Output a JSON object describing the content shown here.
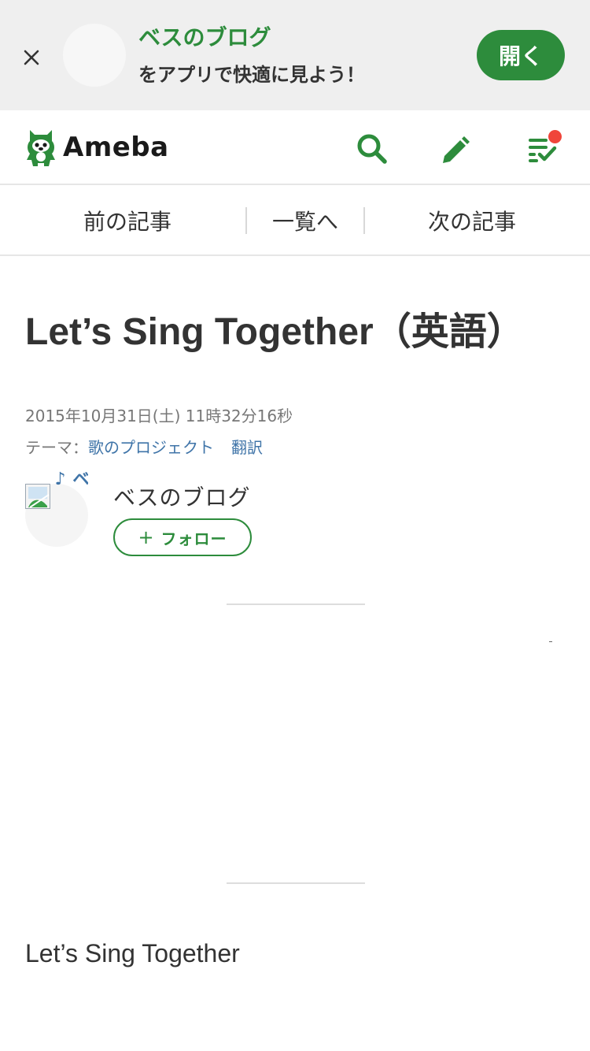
{
  "app_banner": {
    "blog_name": "ベスのブログ",
    "message": "をアプリで快適に見よう！",
    "open_label": "開く"
  },
  "header": {
    "logo_text": "Ameba",
    "icons": [
      "search-icon",
      "edit-icon",
      "reader-feed-icon"
    ],
    "notification_color": "#f0453a"
  },
  "article_nav": {
    "prev_label": "前の記事",
    "list_label": "一覧へ",
    "next_label": "次の記事"
  },
  "article": {
    "title": "Let’s Sing Together（英語）",
    "date": "2015年10月31日(土) 11時32分16秒",
    "theme_label": "テーマ：",
    "theme_links": [
      "歌のプロジェクト",
      "翻訳"
    ],
    "author_name": "ベスのブログ",
    "author_avatar_alt": "ベ♪",
    "follow_label": "フォロー",
    "follow_plus": "+",
    "body_first_line": "Let’s Sing Together"
  },
  "colors": {
    "brand_green": "#2d8c3c",
    "link_blue": "#3f74a8",
    "banner_bg": "#efefef"
  }
}
